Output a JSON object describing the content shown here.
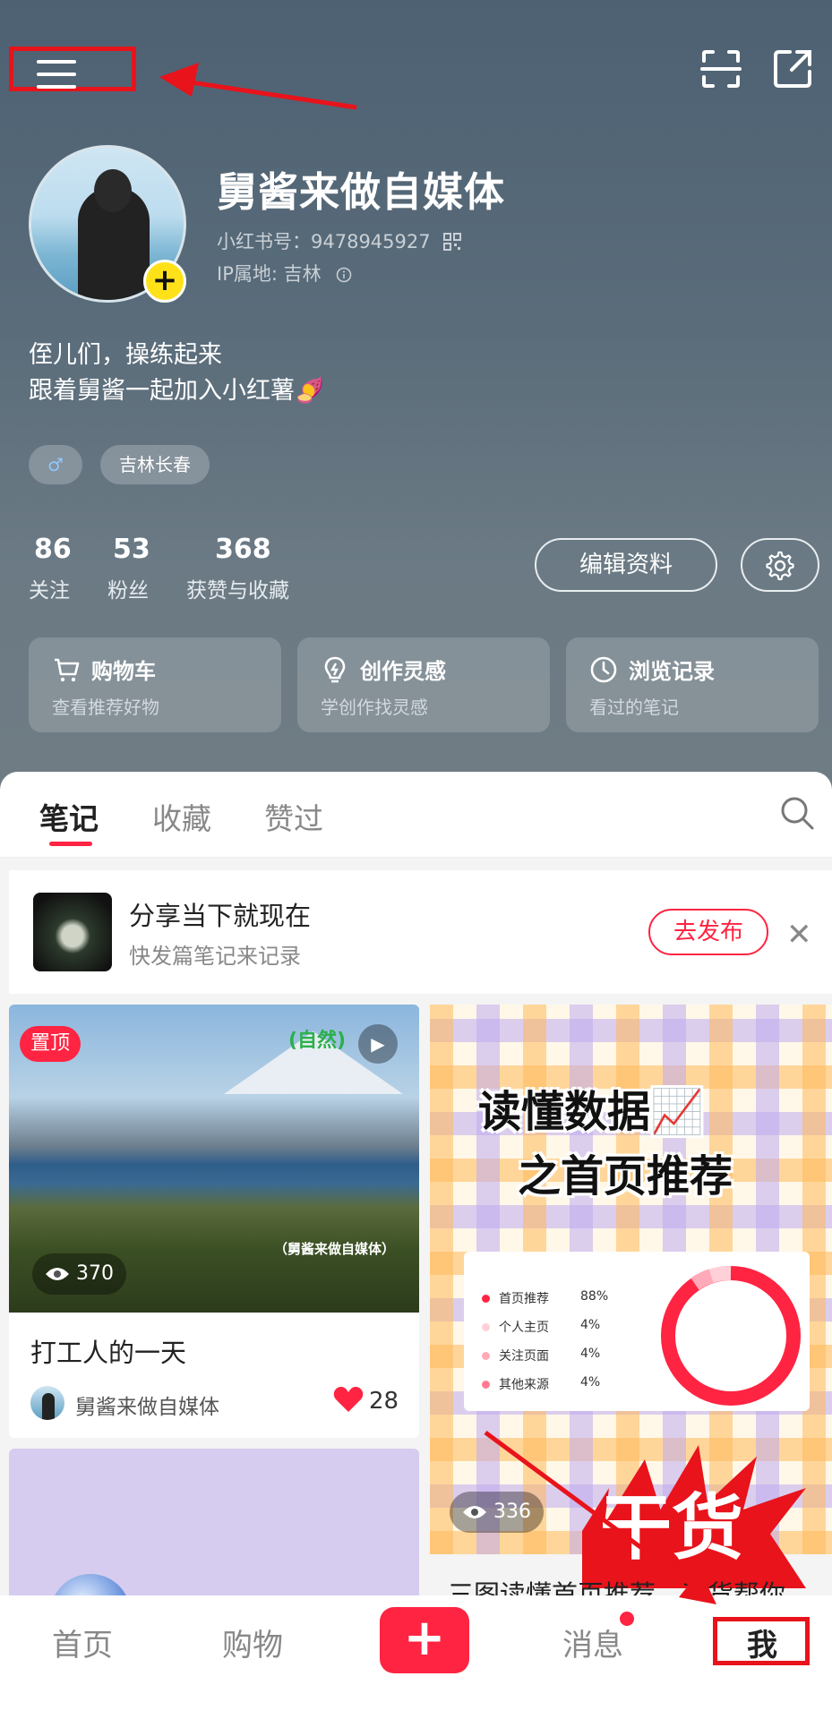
{
  "profile": {
    "name": "舅酱来做自媒体",
    "id_label": "小红书号：9478945927",
    "ip_label": "IP属地: 吉林",
    "bio_line1": "侄儿们，操练起来",
    "bio_line2": "跟着舅酱一起加入小红薯🍠",
    "tags": {
      "gender": "♂",
      "location": "吉林长春"
    },
    "stats": [
      {
        "value": "86",
        "label": "关注"
      },
      {
        "value": "53",
        "label": "粉丝"
      },
      {
        "value": "368",
        "label": "获赞与收藏"
      }
    ],
    "edit_label": "编辑资料"
  },
  "quick_links": [
    {
      "title": "购物车",
      "subtitle": "查看推荐好物",
      "icon": "cart-icon"
    },
    {
      "title": "创作灵感",
      "subtitle": "学创作找灵感",
      "icon": "bulb-icon"
    },
    {
      "title": "浏览记录",
      "subtitle": "看过的笔记",
      "icon": "clock-icon"
    }
  ],
  "tabs": [
    "笔记",
    "收藏",
    "赞过"
  ],
  "share_prompt": {
    "title": "分享当下就现在",
    "subtitle": "快发篇笔记来记录",
    "button": "去发布"
  },
  "notes": [
    {
      "pinned_label": "置顶",
      "views": "370",
      "title": "打工人的一天",
      "author": "舅酱来做自媒体",
      "likes": "28",
      "image_caption": "（舅酱来做自媒体）",
      "brand_mark": "(自然)"
    },
    {
      "views": "336",
      "title": "三图读懂首页推荐，干货帮你",
      "cover_line1": "读懂数据📈",
      "cover_line2": "之首页推荐",
      "cover_burst": "干货",
      "legend": [
        {
          "label": "首页推荐",
          "pct": "88%",
          "color": "#ff2442"
        },
        {
          "label": "个人主页",
          "pct": "4%",
          "color": "#ffd0d8"
        },
        {
          "label": "关注页面",
          "pct": "4%",
          "color": "#ffaab8"
        },
        {
          "label": "其他来源",
          "pct": "4%",
          "color": "#ff7a90"
        }
      ]
    }
  ],
  "bottom_nav": [
    "首页",
    "购物",
    "+",
    "消息",
    "我"
  ],
  "colors": {
    "accent": "#ff2442",
    "annotation": "#e8131b"
  }
}
